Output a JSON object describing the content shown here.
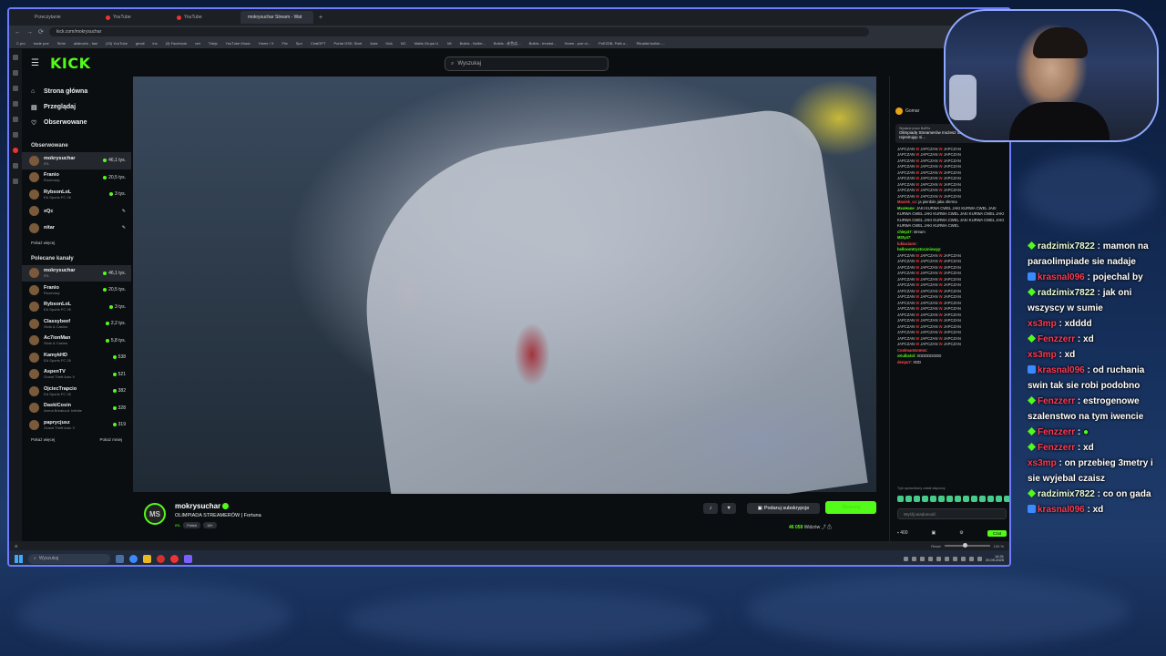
{
  "browser": {
    "tabs": [
      "Przeczytanie",
      "YouTube",
      "YouTube",
      "mokrysuchar Stream - Wat"
    ],
    "url": "kick.com/mokrysuchar",
    "bookmarks": [
      "C pro",
      "trade poe",
      "Strim",
      "allaboelo - fast",
      "(33) YouTube",
      "gmail",
      "ins",
      "(3) Facebook",
      "net",
      "Tdejs",
      "YouTube Music",
      "Home / X",
      "Flix",
      "Spo",
      "ChatGPT",
      "Portal OSK: Start",
      "Auta",
      "Kick",
      "NC",
      "Matta Grupa U.",
      "Mt",
      "Builds - Nulfer...",
      "Builds - 赤色店...",
      "Builds - trendst...",
      "Home - poe.ni...",
      "PoE2DB, Path o...",
      "Ritualist builds -..."
    ],
    "status_left": "Reset",
    "zoom": "100 %"
  },
  "kick": {
    "logo": "KICK",
    "search_placeholder": "Wyszukaj",
    "nav": [
      {
        "label": "Strona główna",
        "icon": "home-icon"
      },
      {
        "label": "Przeglądaj",
        "icon": "browse-icon"
      },
      {
        "label": "Obserwowane",
        "icon": "heart-icon"
      }
    ],
    "followed_title": "Obserwowane",
    "followed": [
      {
        "name": "mokrysuchar",
        "cat": "IRL",
        "viewers": "46,1 tys."
      },
      {
        "name": "Franio",
        "cat": "Rozmowy",
        "viewers": "20,5 tys."
      },
      {
        "name": "RybsonLoL",
        "cat": "EA Sports FC 26",
        "viewers": "3 tys."
      },
      {
        "name": "xQc",
        "cat": "",
        "viewers": ""
      },
      {
        "name": "nitar",
        "cat": "",
        "viewers": ""
      }
    ],
    "show_more": "Pokaż więcej",
    "recommended_title": "Polecane kanały",
    "recommended": [
      {
        "name": "mokrysuchar",
        "cat": "IRL",
        "viewers": "46,1 tys."
      },
      {
        "name": "Franio",
        "cat": "Rozmowy",
        "viewers": "20,5 tys."
      },
      {
        "name": "RybsonLoL",
        "cat": "EA Sports FC 26",
        "viewers": "3 tys."
      },
      {
        "name": "Classybeef",
        "cat": "Slots & Casino",
        "viewers": "2,2 tys."
      },
      {
        "name": "Ac7ionMan",
        "cat": "Slots & Casino",
        "viewers": "5,8 tys."
      },
      {
        "name": "KamykHD",
        "cat": "EA Sports FC 26",
        "viewers": "538"
      },
      {
        "name": "AspenTV",
        "cat": "Grand Theft Auto V",
        "viewers": "521"
      },
      {
        "name": "OjciecTrapcio",
        "cat": "EA Sports FC 26",
        "viewers": "382"
      },
      {
        "name": "DaskiCosin",
        "cat": "Arena Breakout: Infinite",
        "viewers": "328"
      },
      {
        "name": "paprycjusz",
        "cat": "Grand Theft Auto V",
        "viewers": "319"
      }
    ],
    "show_more2": "Pokaż więcej",
    "show_less": "Pokaż mniej"
  },
  "stream": {
    "avatar_text": "MS",
    "name": "mokrysuchar",
    "title": "OLIMPIADA STREAMERÓW | Fortuna",
    "tags": [
      "IRL",
      "Polish",
      "18+"
    ],
    "subscribe": "Podaruj subskrypcje",
    "follow": "Obserwuj",
    "viewers_count": "46 059",
    "viewers_label": "Widzów"
  },
  "chat": {
    "sender": "Gomar",
    "pin_meta": "Wysłane przez BotRix",
    "pin_text": "Olimpiadę Streamerów możesz obstawiać w Fortunie! A rejestrując si...",
    "spam_word": "JAPCZAN",
    "messages": [
      {
        "user": "Maciek_cc",
        "text": "ja pierdole jaka oferma",
        "color": "r"
      },
      {
        "user": "MxoHane",
        "text": "JAKI KURWA CWEL JAKI KURWA CWEL JAKI KURWA CWEL JAKI KURWA CWEL JAKI KURWA CWEL JAKI KURWA CWEL JAKI KURWA CWEL JAKI KURWA CWEL JAKI KURWA CWEL JAKI KURWA CWEL",
        "color": "g"
      },
      {
        "user": "chlep37",
        "text": "stream",
        "color": "g"
      },
      {
        "user": "M2ty47",
        "text": "",
        "color": "g"
      },
      {
        "user": "lukiaciano",
        "text": "",
        "color": "r"
      },
      {
        "user": "hellocentrystoczniowyy",
        "text": "",
        "color": "g"
      }
    ],
    "tail": [
      {
        "user": "CoolmanGomez",
        "text": "",
        "color": "r"
      },
      {
        "user": "xKulbstol",
        "text": "XDDDDDDDD",
        "color": "g"
      },
      {
        "user": "denpu7",
        "text": "XDD",
        "color": "r"
      }
    ],
    "mode_note": "Tryb spowolniony został włączony",
    "input_placeholder": "Wyślij wiadomość",
    "points": "400",
    "send": "Czat"
  },
  "overlay_chat": [
    {
      "user": "radzimix7822",
      "text": "mamon na paraolimpiade sie nadaje",
      "badge": "g",
      "color": "g"
    },
    {
      "user": "krasnal096",
      "text": "pojechal by",
      "badge": "b",
      "color": "r"
    },
    {
      "user": "radzimix7822",
      "text": "jak oni wszyscy w sumie",
      "badge": "g",
      "color": "g"
    },
    {
      "user": "xs3mp",
      "text": "xdddd",
      "badge": "",
      "color": "r"
    },
    {
      "user": "Fenzzerr",
      "text": "xd",
      "badge": "g",
      "color": "r"
    },
    {
      "user": "xs3mp",
      "text": "xd",
      "badge": "",
      "color": "r"
    },
    {
      "user": "krasnal096",
      "text": "od ruchania swin tak sie robi podobno",
      "badge": "b",
      "color": "r"
    },
    {
      "user": "Fenzzerr",
      "text": "estrogenowe szalenstwo na tym iwencie",
      "badge": "g",
      "color": "r"
    },
    {
      "user": "Fenzzerr",
      "text": "",
      "badge": "g",
      "color": "r"
    },
    {
      "user": "Fenzzerr",
      "text": "xd",
      "badge": "g",
      "color": "r"
    },
    {
      "user": "xs3mp",
      "text": "on przebieg 3metry i sie wyjebal czaisz",
      "badge": "",
      "color": "r"
    },
    {
      "user": "radzimix7822",
      "text": "co on gada",
      "badge": "g",
      "color": "g"
    },
    {
      "user": "krasnal096",
      "text": "xd",
      "badge": "b",
      "color": "r"
    }
  ],
  "taskbar": {
    "search": "Wyszukaj",
    "time": "14:31",
    "date": "20.09.2025"
  }
}
